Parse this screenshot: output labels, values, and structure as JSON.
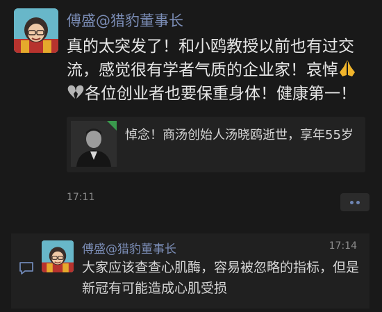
{
  "post": {
    "author": "傅盛@猎豹董事长",
    "text_part1": "真的太突发了！和小鸥教授以前也有过交流，感觉很有学者气质的企业家！哀悼",
    "text_part2": "各位创业者也要保重身体！健康第一！",
    "emoji_1": "folded-hands-icon",
    "emoji_2": "broken-heart-icon",
    "time": "17:11"
  },
  "link_card": {
    "title": "悼念！商汤创始人汤晓鸥逝世，享年55岁"
  },
  "comment": {
    "author": "傅盛@猎豹董事长",
    "time": "17:14",
    "text": "大家应该查查心肌酶，容易被忽略的指标，但是新冠有可能造成心肌受损"
  },
  "colors": {
    "background": "#191919",
    "name_link": "#7b8db6",
    "text": "#e6e6e6",
    "meta": "#8b8b8b"
  }
}
